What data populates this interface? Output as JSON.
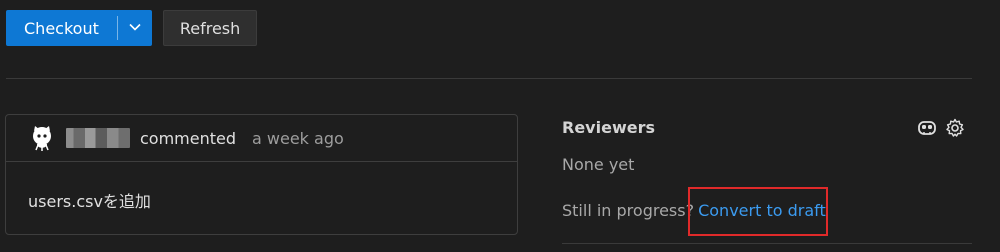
{
  "toolbar": {
    "checkout_label": "Checkout",
    "refresh_label": "Refresh",
    "accent_color": "#0e78d4"
  },
  "comment": {
    "author": "",
    "verb": "commented",
    "time": "a week ago",
    "body": "users.csvを追加",
    "avatar_icon": "github-octocat-icon"
  },
  "reviewers": {
    "title": "Reviewers",
    "none_text": "None yet",
    "progress_text": "Still in progress?",
    "convert_link": "Convert to draft",
    "icons": [
      "copilot-icon",
      "gear-icon"
    ]
  }
}
